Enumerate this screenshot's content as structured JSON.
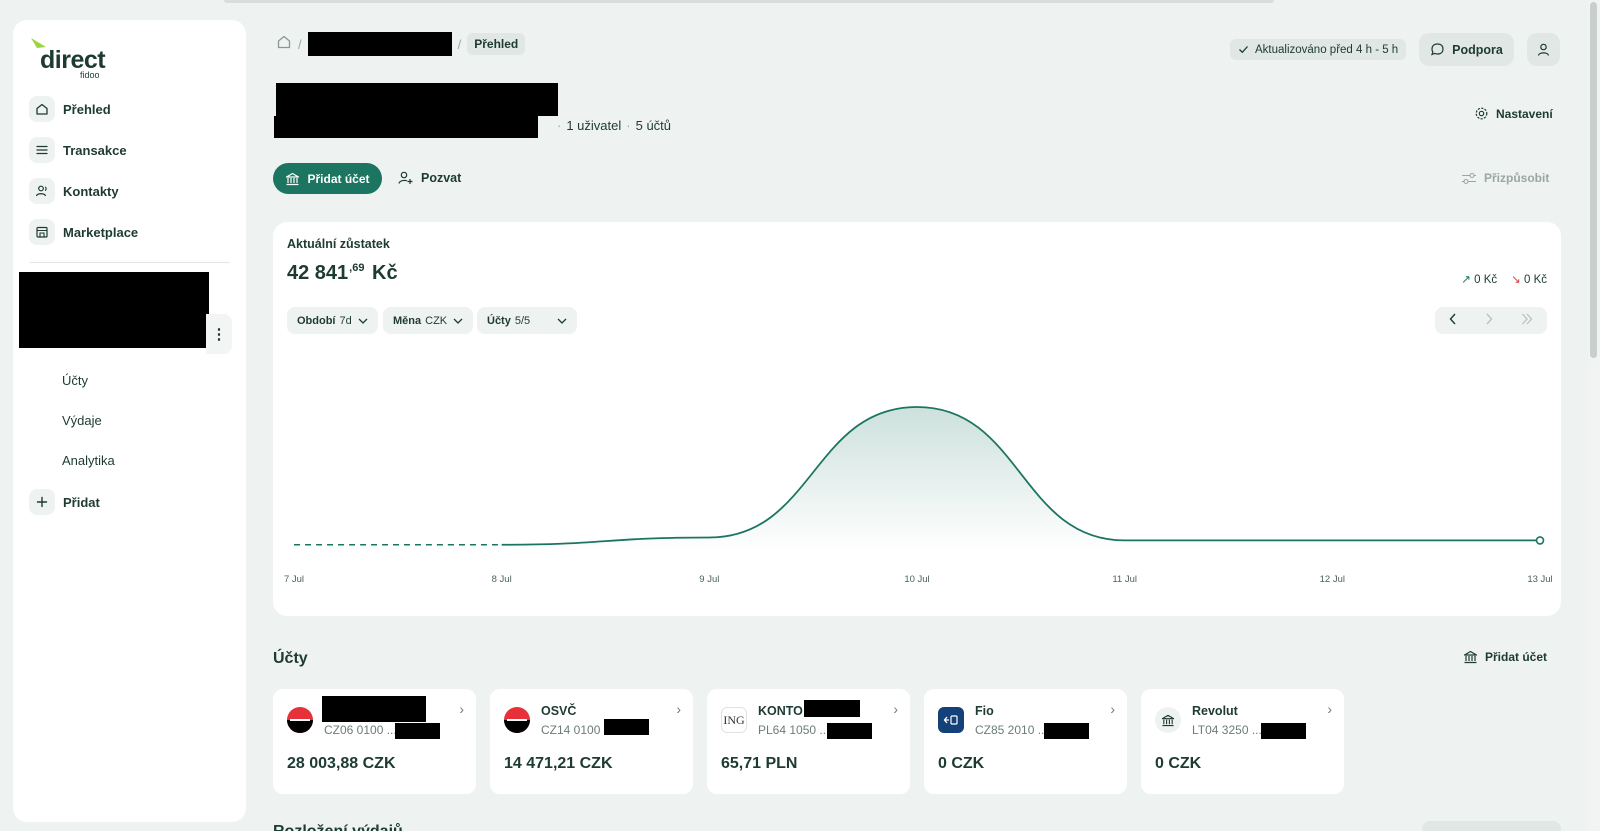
{
  "brand": {
    "logo_word": "direct",
    "logo_sub": "fidoo",
    "accent": "#1b7560",
    "lime": "#9bd43f"
  },
  "sidebar": {
    "items": [
      {
        "label": "Přehled",
        "icon": "home-icon"
      },
      {
        "label": "Transakce",
        "icon": "list-icon"
      },
      {
        "label": "Kontakty",
        "icon": "users-icon"
      },
      {
        "label": "Marketplace",
        "icon": "store-icon"
      }
    ],
    "sub_items": [
      "Účty",
      "Výdaje",
      "Analytika"
    ],
    "add_label": "Přidat"
  },
  "header": {
    "breadcrumb_current": "Přehled",
    "updated": "Aktualizováno před 4 h - 5 h",
    "support": "Podpora",
    "meta_users": "1 uživatel",
    "meta_accounts": "5 účtů",
    "settings": "Nastavení"
  },
  "actions": {
    "add_account": "Přidat účet",
    "invite": "Pozvat",
    "customize": "Přizpůsobit"
  },
  "balance_card": {
    "title": "Aktuální zůstatek",
    "balance_main": "42 841",
    "balance_decimals": ",69",
    "balance_currency": "Kč",
    "inflow": "0 Kč",
    "outflow": "0 Kč",
    "filters": [
      {
        "label": "Období",
        "value": "7d"
      },
      {
        "label": "Měna",
        "value": "CZK"
      },
      {
        "label": "Účty",
        "value": "5/5"
      }
    ]
  },
  "chart_data": {
    "type": "area",
    "x": [
      "7 Jul",
      "8 Jul",
      "9 Jul",
      "10 Jul",
      "11 Jul",
      "12 Jul",
      "13 Jul"
    ],
    "categories": [
      "7 Jul",
      "8 Jul",
      "9 Jul",
      "10 Jul",
      "11 Jul",
      "12 Jul",
      "13 Jul"
    ],
    "series": [
      {
        "values": [
          0.05,
          0.05,
          0.1,
          1.0,
          0.08,
          0.08,
          0.08
        ]
      }
    ],
    "ylabel": "",
    "grid": false,
    "dashed_segment": [
      "7 Jul",
      "8 Jul"
    ]
  },
  "accounts": {
    "title": "Účty",
    "add_label": "Přidat účet",
    "items": [
      {
        "name": "",
        "iban": "CZ06 0100 ...",
        "balance": "28 003,88 CZK",
        "logo": "kb-logo"
      },
      {
        "name": "OSVČ",
        "iban": "CZ14 0100 ...",
        "balance": "14 471,21 CZK",
        "logo": "kb-logo"
      },
      {
        "name": "KONTO",
        "iban": "PL64 1050 ...",
        "balance": "65,71 PLN",
        "logo": "ing-logo",
        "logo_text": "ING"
      },
      {
        "name": "Fio",
        "iban": "CZ85 2010 ...",
        "balance": "0 CZK",
        "logo": "fio-logo"
      },
      {
        "name": "Revolut",
        "iban": "LT04 3250 ...",
        "balance": "0 CZK",
        "logo": "bank-icon"
      }
    ]
  },
  "next_section_title": "Rozložení výdajů"
}
